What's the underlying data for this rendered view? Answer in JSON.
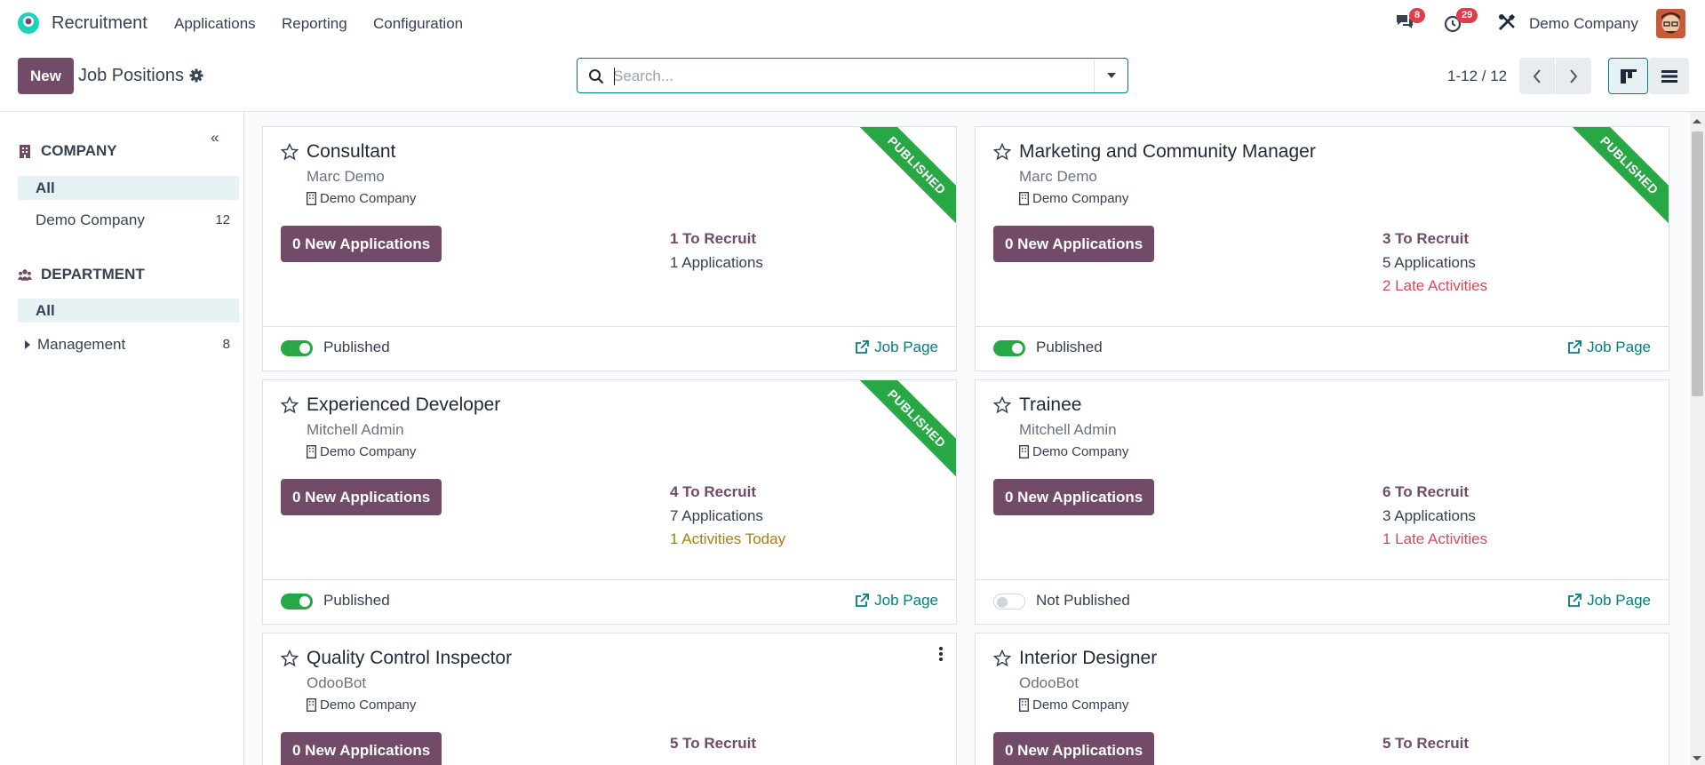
{
  "navbar": {
    "app_name": "Recruitment",
    "menus": [
      "Applications",
      "Reporting",
      "Configuration"
    ],
    "messages_count": "8",
    "activities_count": "29",
    "company": "Demo Company"
  },
  "control_panel": {
    "new_label": "New",
    "title": "Job Positions",
    "search_placeholder": "Search...",
    "pager": "1-12 / 12"
  },
  "sidebar": {
    "company_heading": "COMPANY",
    "company_items": [
      {
        "label": "All",
        "count": ""
      },
      {
        "label": "Demo Company",
        "count": "12"
      }
    ],
    "department_heading": "DEPARTMENT",
    "department_items": [
      {
        "label": "All",
        "count": ""
      },
      {
        "label": "Management",
        "count": "8"
      }
    ]
  },
  "cards": [
    {
      "title": "Consultant",
      "owner": "Marc Demo",
      "company": "Demo Company",
      "new_apps": "0 New Applications",
      "to_recruit": "1 To Recruit",
      "applications": "1 Applications",
      "extra": "",
      "published_label": "Published",
      "job_page": "Job Page",
      "ribbon": "PUBLISHED"
    },
    {
      "title": "Marketing and Community Manager",
      "owner": "Marc Demo",
      "company": "Demo Company",
      "new_apps": "0 New Applications",
      "to_recruit": "3 To Recruit",
      "applications": "5 Applications",
      "extra": "2 Late Activities",
      "published_label": "Published",
      "job_page": "Job Page",
      "ribbon": "PUBLISHED"
    },
    {
      "title": "Experienced Developer",
      "owner": "Mitchell Admin",
      "company": "Demo Company",
      "new_apps": "0 New Applications",
      "to_recruit": "4 To Recruit",
      "applications": "7 Applications",
      "extra": "1 Activities Today",
      "published_label": "Published",
      "job_page": "Job Page",
      "ribbon": "PUBLISHED"
    },
    {
      "title": "Trainee",
      "owner": "Mitchell Admin",
      "company": "Demo Company",
      "new_apps": "0 New Applications",
      "to_recruit": "6 To Recruit",
      "applications": "3 Applications",
      "extra": "1 Late Activities",
      "published_label": "Not Published",
      "job_page": "Job Page",
      "ribbon": ""
    },
    {
      "title": "Quality Control Inspector",
      "owner": "OdooBot",
      "company": "Demo Company",
      "new_apps": "0 New Applications",
      "to_recruit": "5 To Recruit"
    },
    {
      "title": "Interior Designer",
      "owner": "OdooBot",
      "company": "Demo Company",
      "new_apps": "0 New Applications",
      "to_recruit": "5 To Recruit"
    }
  ],
  "colors": {
    "brand": "#714b67",
    "accent": "#017e84",
    "published": "#28a745",
    "late": "#d44c59",
    "today": "#b07d0c"
  }
}
